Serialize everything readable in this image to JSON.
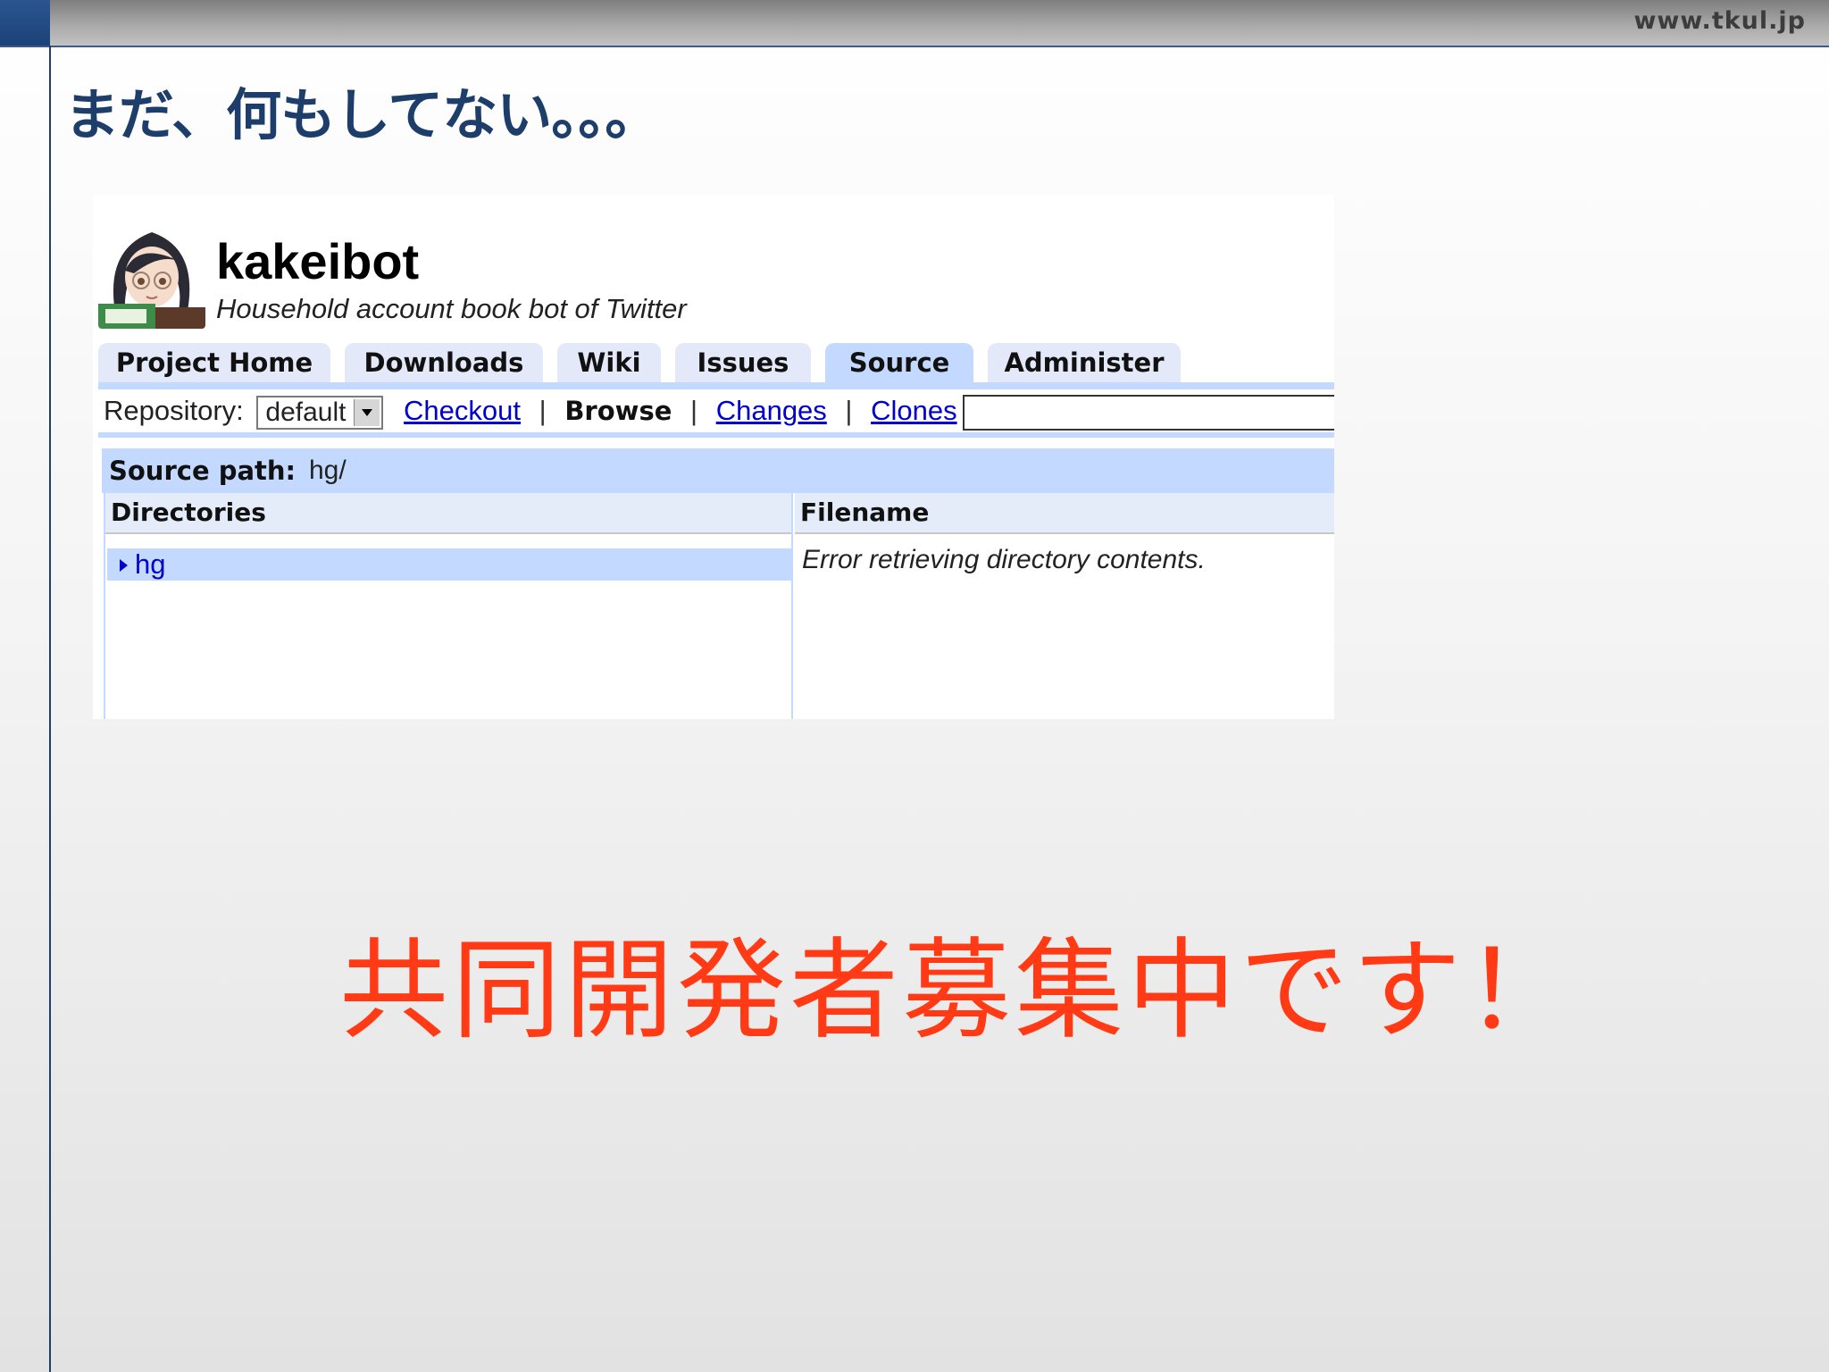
{
  "site": {
    "url": "www.tkul.jp"
  },
  "slide": {
    "title": "まだ、何もしてない。。。",
    "message": "共同開発者募集中です！"
  },
  "project": {
    "name": "kakeibot",
    "summary": "Household account book bot of Twitter"
  },
  "tabs": [
    {
      "label": "Project Home"
    },
    {
      "label": "Downloads"
    },
    {
      "label": "Wiki"
    },
    {
      "label": "Issues"
    },
    {
      "label": "Source",
      "active": true
    },
    {
      "label": "Administer"
    }
  ],
  "subnav": {
    "repository_label": "Repository:",
    "repository_value": "default",
    "links": {
      "checkout": "Checkout",
      "browse": "Browse",
      "changes": "Changes",
      "clones": "Clones"
    },
    "separator": "|",
    "search_value": ""
  },
  "source_path": {
    "label": "Source path:",
    "value": "hg/"
  },
  "directories": {
    "header": "Directories",
    "items": [
      {
        "name": "hg"
      }
    ]
  },
  "files": {
    "header": "Filename",
    "message": "Error retrieving directory contents."
  },
  "colors": {
    "accent_blue": "#c3d9ff",
    "link": "#0000cc",
    "title_navy": "#1d3d6b",
    "message_red": "#ff3a14"
  }
}
